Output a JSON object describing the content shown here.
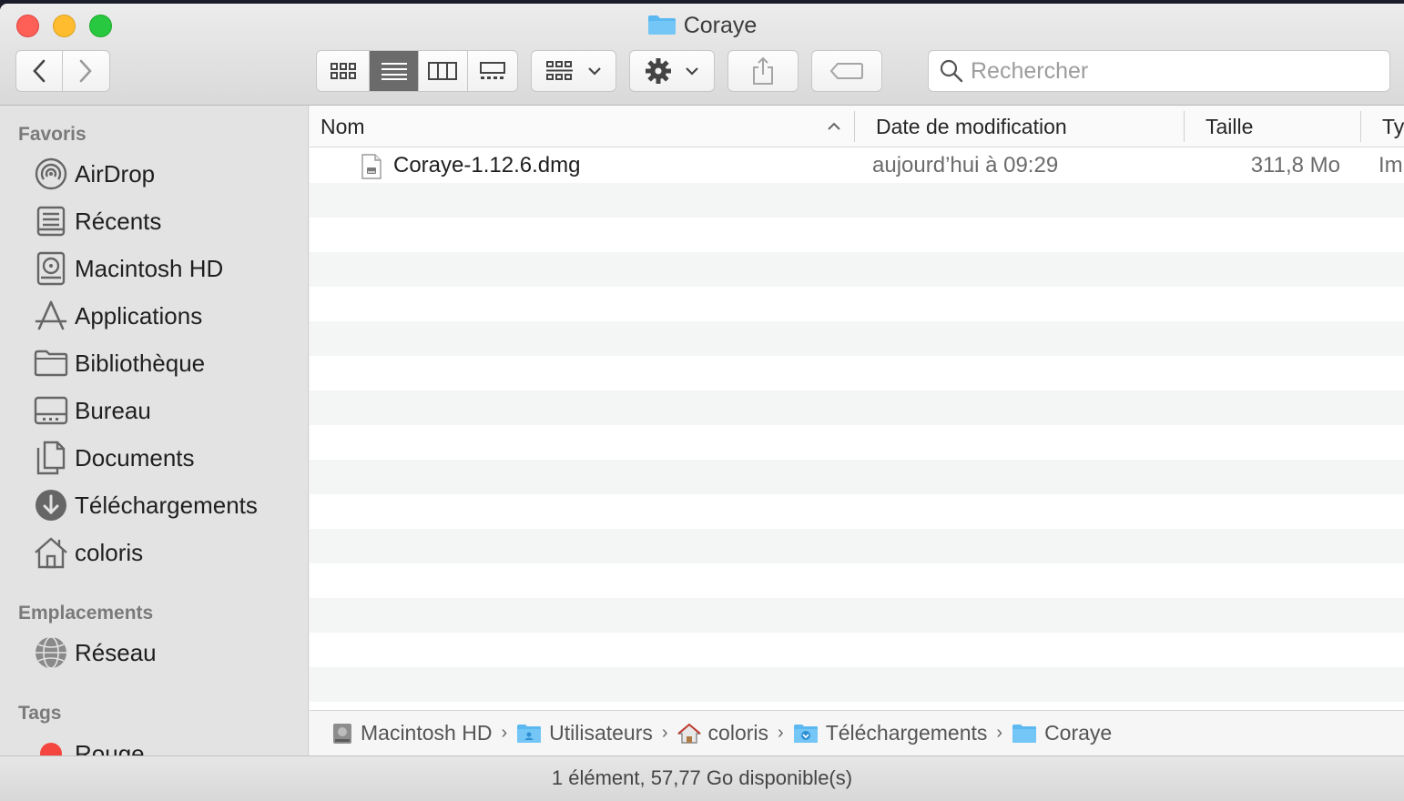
{
  "window": {
    "title": "Coraye"
  },
  "search": {
    "placeholder": "Rechercher"
  },
  "sidebar": {
    "favorites_heading": "Favoris",
    "favorites": [
      {
        "label": "AirDrop",
        "icon": "airdrop-icon"
      },
      {
        "label": "Récents",
        "icon": "recents-icon"
      },
      {
        "label": "Macintosh HD",
        "icon": "hard-drive-icon"
      },
      {
        "label": "Applications",
        "icon": "applications-icon"
      },
      {
        "label": "Bibliothèque",
        "icon": "folder-icon"
      },
      {
        "label": "Bureau",
        "icon": "desktop-icon"
      },
      {
        "label": "Documents",
        "icon": "documents-icon"
      },
      {
        "label": "Téléchargements",
        "icon": "downloads-icon"
      },
      {
        "label": "coloris",
        "icon": "home-icon"
      }
    ],
    "locations_heading": "Emplacements",
    "locations": [
      {
        "label": "Réseau",
        "icon": "network-icon"
      }
    ],
    "tags_heading": "Tags",
    "tags": [
      {
        "label": "Rouge",
        "color": "#f4453e"
      }
    ]
  },
  "list": {
    "columns": {
      "name": "Nom",
      "date": "Date de modification",
      "size": "Taille",
      "kind": "Ty"
    },
    "files": [
      {
        "name": "Coraye-1.12.6.dmg",
        "date": "aujourd’hui à 09:29",
        "size": "311,8 Mo",
        "kind": "Im"
      }
    ]
  },
  "pathbar": [
    {
      "label": "Macintosh HD",
      "icon": "hard-drive-icon"
    },
    {
      "label": "Utilisateurs",
      "icon": "users-folder-icon"
    },
    {
      "label": "coloris",
      "icon": "home-icon"
    },
    {
      "label": "Téléchargements",
      "icon": "downloads-folder-icon"
    },
    {
      "label": "Coraye",
      "icon": "folder-icon"
    }
  ],
  "statusbar": {
    "text": "1 élément, 57,77 Go disponible(s)"
  },
  "colors": {
    "folder_blue": "#5bb8f0",
    "selected_view": "#6b6b6b"
  }
}
